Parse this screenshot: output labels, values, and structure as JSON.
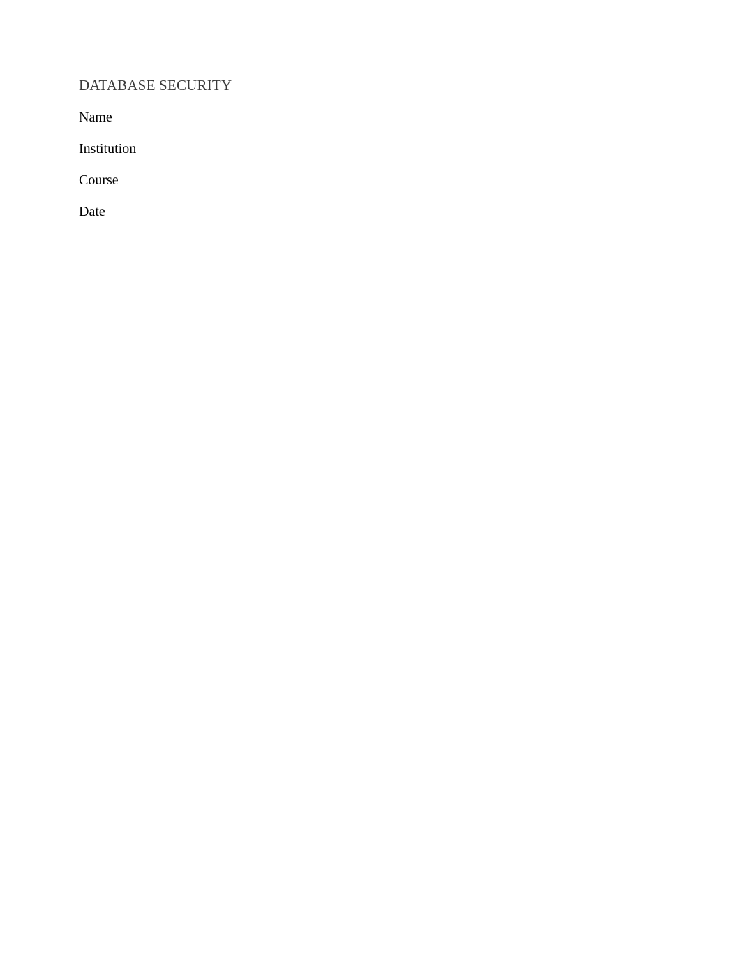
{
  "document": {
    "title": "DATABASE SECURITY",
    "fields": {
      "name": "Name",
      "institution": "Institution",
      "course": "Course",
      "date": "Date"
    }
  }
}
